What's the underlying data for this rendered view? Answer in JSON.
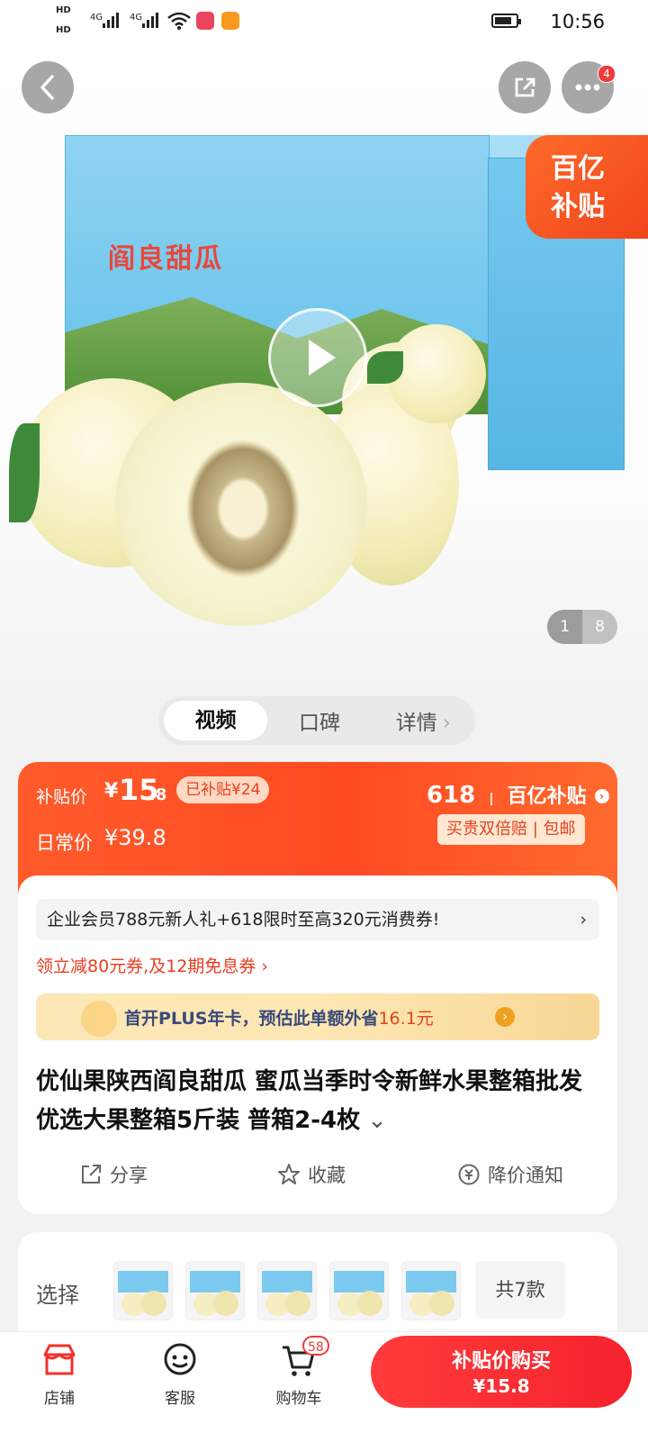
{
  "status_bar": {
    "time": "10:56",
    "net1": "4G",
    "net2": "4G",
    "hd1": "HD",
    "hd2": "HD",
    "icons": [
      "signal-icon",
      "wifi-icon",
      "battery-icon"
    ]
  },
  "header": {
    "back_icon": "chevron-left-icon",
    "share_icon": "share-icon",
    "more_icon": "more-icon",
    "more_badge": "4"
  },
  "gallery": {
    "subsidy_line1": "百亿",
    "subsidy_line2": "补贴",
    "box_brand": "阎良甜瓜",
    "current_page": "1",
    "total_pages": "8"
  },
  "tabs": [
    {
      "label": "视频",
      "active": true
    },
    {
      "label": "口碑",
      "active": false
    },
    {
      "label": "详情",
      "active": false
    }
  ],
  "price": {
    "subsidy_label": "补贴价",
    "currency": "¥",
    "subsidy_int": "15",
    "subsidy_dec": ".8",
    "subsidy_tag": "已补贴¥24",
    "regular_label": "日常价",
    "regular_price": "¥39.8",
    "promo_logo_618": "618",
    "promo_logo_text": "百亿补贴",
    "guarantee": "买贵双倍赔 | 包邮"
  },
  "promo": {
    "text": "企业会员788元新人礼+618限时至高320元消费券!",
    "chevron": "›",
    "coupon": "领立减80元券,及12期免息券 ›",
    "plus_text": "首开PLUS年卡，预估此单额外省",
    "plus_amount": "16.1元"
  },
  "product": {
    "title": "优仙果陕西阎良甜瓜 蜜瓜当季时令新鲜水果整箱批发 优选大果整箱5斤装 普箱2-4枚"
  },
  "actions": [
    {
      "label": "分享",
      "icon": "share-icon"
    },
    {
      "label": "收藏",
      "icon": "star-icon"
    },
    {
      "label": "降价通知",
      "icon": "price-drop-icon"
    }
  ],
  "selection": {
    "label": "选择",
    "total": "共7款"
  },
  "bottom_nav": {
    "store": "店铺",
    "service": "客服",
    "cart": "购物车",
    "cart_count": "58",
    "buy_line1": "补贴价购买",
    "buy_line2": "¥15.8"
  },
  "colors": {
    "accent": "#ff4a22",
    "buy": "#f5222d"
  }
}
